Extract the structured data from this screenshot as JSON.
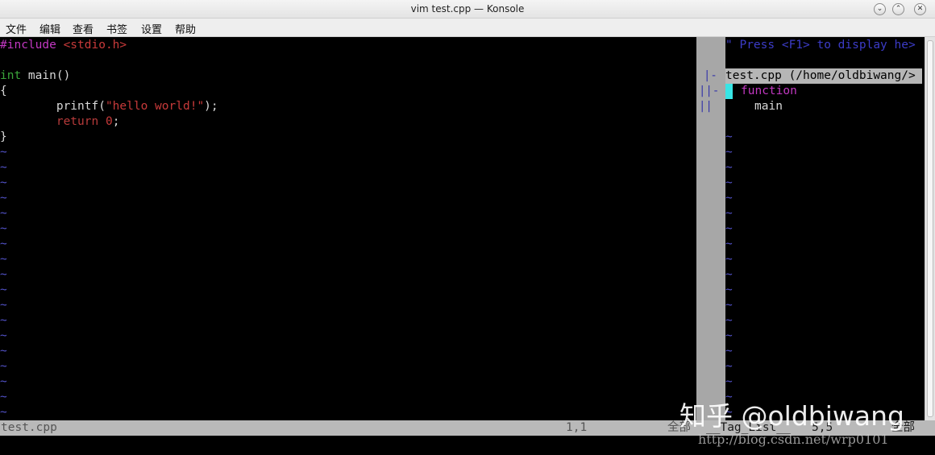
{
  "window": {
    "title": "vim test.cpp — Konsole",
    "buttons": {
      "minimize": "⌄",
      "maximize": "⌃",
      "close": "✕"
    }
  },
  "menu": [
    "文件",
    "编辑",
    "查看",
    "书签",
    "设置",
    "帮助"
  ],
  "editor": {
    "lines": {
      "l1_directive": "#include",
      "l1_header": "<stdio.h>",
      "l3_type": "int",
      "l3_rest": " main()",
      "l4": "{",
      "l5_call": "        printf(",
      "l5_str": "\"hello world!\"",
      "l5_end": ");",
      "l6_kw": "        return",
      "l6_num": "0",
      "l6_end": ";",
      "l7": "}"
    },
    "tilde": "~"
  },
  "taglist": {
    "help": "\" Press <F1> to display he>",
    "file": "test.cpp (/home/oldbiwang/>",
    "kind": "function",
    "tag": "main",
    "fold_marks": [
      "|-",
      "||-",
      "||"
    ]
  },
  "status": {
    "filename": "test.cpp",
    "position": "1,1",
    "scroll": "全部",
    "tag_name": "__Tag_List__",
    "tag_position": "5,5",
    "tag_scroll": "全部"
  },
  "watermarks": {
    "zhihu": "知乎 @oldbiwang",
    "csdn": "http://blog.csdn.net/wrp0101"
  },
  "colors": {
    "tilde": "#5252c8",
    "preproc": "#c238c2",
    "string": "#c83a3a",
    "type": "#3aa53a",
    "cursor": "#38e5e5"
  }
}
